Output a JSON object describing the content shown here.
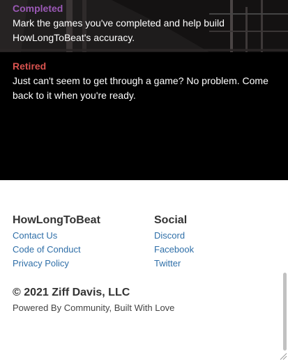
{
  "features": [
    {
      "title": "Completed",
      "title_color": "#9b59b6",
      "description": "Mark the games you've completed and help build HowLongToBeat's accuracy."
    },
    {
      "title": "Retired",
      "title_color": "#d9534f",
      "description": "Just can't seem to get through a game? No problem. Come back to it when you're ready."
    }
  ],
  "footer": {
    "brand": {
      "heading": "HowLongToBeat",
      "links": [
        "Contact Us",
        "Code of Conduct",
        "Privacy Policy"
      ]
    },
    "social": {
      "heading": "Social",
      "links": [
        "Discord",
        "Facebook",
        "Twitter"
      ]
    },
    "copyright": "© 2021 Ziff Davis, LLC",
    "powered_by": "Powered By Community, Built With Love"
  },
  "colors": {
    "hero_bg": "#000000",
    "link": "#2f6fa8",
    "heading": "#333333"
  }
}
